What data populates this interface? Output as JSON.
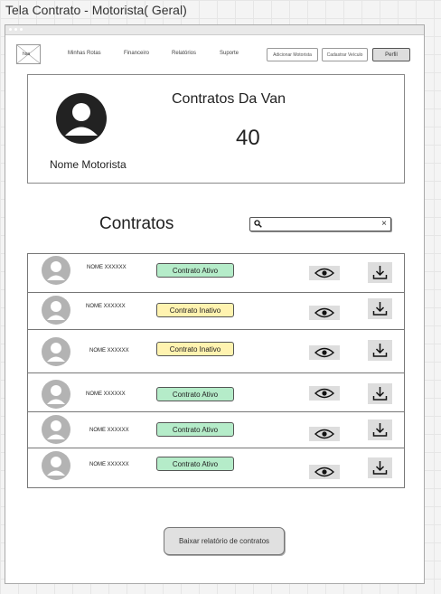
{
  "frame_title": "Tela Contrato  - Motorista( Geral)",
  "nav": {
    "logo_text": "hsa",
    "links": [
      "Minhas Rotas",
      "Financeiro",
      "Relatórios",
      "Suporte"
    ],
    "add_driver": "Adicionar Motorista",
    "add_vehicle": "Cadastrar Veículo",
    "profile": "Perfil"
  },
  "summary": {
    "driver_name": "Nome Motorista",
    "title": "Contratos Da Van",
    "count": "40"
  },
  "contracts": {
    "title": "Contratos",
    "search": {
      "value": "",
      "clear": "×",
      "icon": "search-icon"
    },
    "rows": [
      {
        "name": "NOME XXXXXX",
        "status": "Contrato Ativo",
        "status_type": "active"
      },
      {
        "name": "NOME XXXXXX",
        "status": "Contrato Inativo",
        "status_type": "inactive"
      },
      {
        "name": "NOME XXXXXX",
        "status": "Contrato Inativo",
        "status_type": "inactive"
      },
      {
        "name": "NOME XXXXXX",
        "status": "Contrato Ativo",
        "status_type": "active"
      },
      {
        "name": "NOME XXXXXX",
        "status": "Contrato Ativo",
        "status_type": "active"
      },
      {
        "name": "NOME XXXXXX",
        "status": "Contrato Ativo",
        "status_type": "active"
      }
    ]
  },
  "report_button": "Baixar relatório de contratos",
  "colors": {
    "active": "#b5ecc9",
    "inactive": "#fff3b0"
  }
}
